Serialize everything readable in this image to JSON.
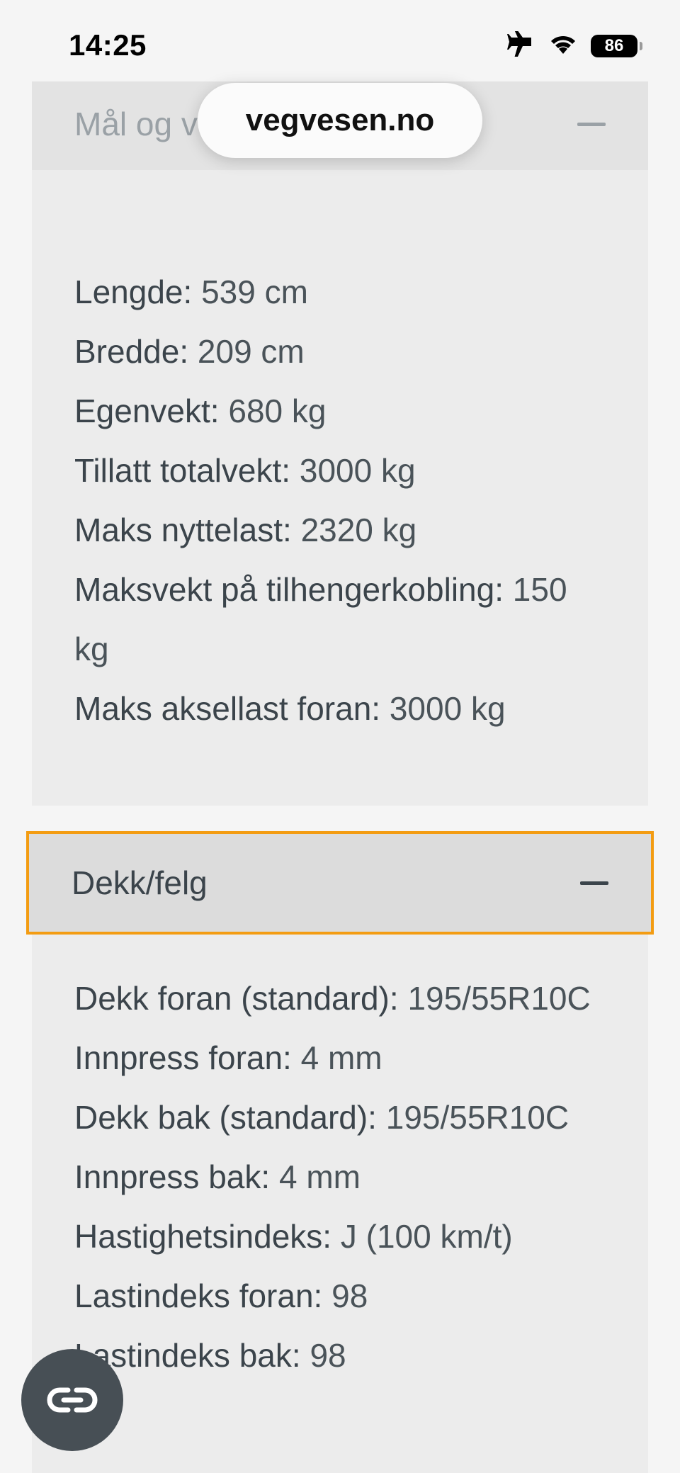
{
  "status_bar": {
    "time": "14:25",
    "battery": "86",
    "icons": [
      "airplane-icon",
      "wifi-icon",
      "battery-icon"
    ]
  },
  "browser": {
    "url": "vegvesen.no"
  },
  "sections": {
    "mal": {
      "title": "Mål og vekt",
      "rows": [
        {
          "label": "Lengde:",
          "value": "539 cm"
        },
        {
          "label": "Bredde:",
          "value": "209 cm"
        },
        {
          "label": "Egenvekt:",
          "value": "680 kg"
        },
        {
          "label": "Tillatt totalvekt:",
          "value": "3000 kg"
        },
        {
          "label": "Maks nyttelast:",
          "value": "2320 kg"
        },
        {
          "label": "Maksvekt på tilhengerkobling:",
          "value": "150 kg"
        },
        {
          "label": "Maks aksellast foran:",
          "value": "3000 kg"
        }
      ]
    },
    "dekk": {
      "title": "Dekk/felg",
      "rows": [
        {
          "label": "Dekk foran (standard):",
          "value": "195/55R10C"
        },
        {
          "label": "Innpress foran:",
          "value": "4 mm"
        },
        {
          "label": "Dekk bak (standard):",
          "value": "195/55R10C"
        },
        {
          "label": "Innpress bak:",
          "value": "4 mm"
        },
        {
          "label": "Hastighetsindeks:",
          "value": "J (100 km/t)"
        },
        {
          "label": "Lastindeks foran:",
          "value": "98"
        },
        {
          "label": "Lastindeks bak:",
          "value": "98"
        }
      ]
    }
  },
  "colors": {
    "focus_outline": "#f39c12",
    "text": "#3b444b",
    "fab_bg": "#474f55"
  }
}
